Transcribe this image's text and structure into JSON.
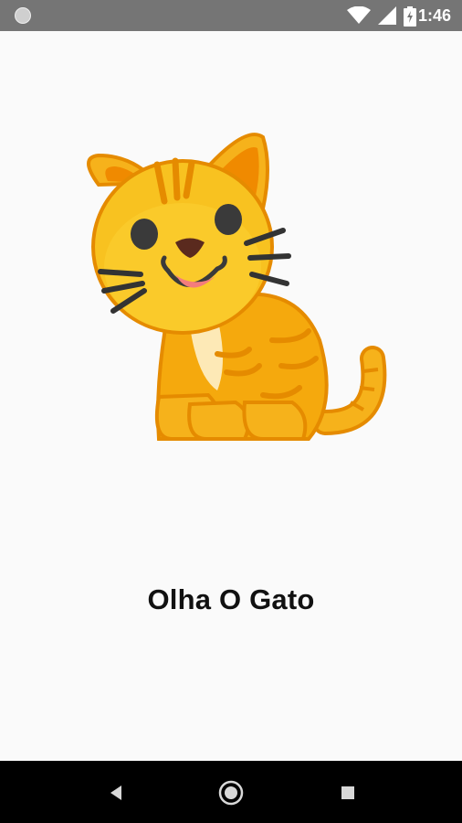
{
  "status_bar": {
    "time": "1:46",
    "icons": [
      "notification-dot-icon",
      "wifi-icon",
      "signal-icon",
      "battery-icon"
    ]
  },
  "main": {
    "title": "Olha O Gato",
    "illustration": "cat-emoji-icon"
  },
  "nav_bar": {
    "buttons": [
      "back-icon",
      "home-icon",
      "recents-icon"
    ]
  }
}
